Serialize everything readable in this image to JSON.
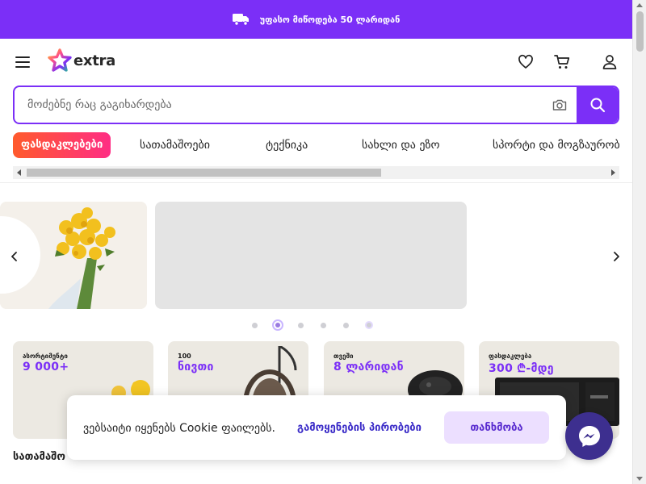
{
  "promo": {
    "text": "უფასო მიწოდება 50 ლარიდან"
  },
  "header": {
    "logo_text": "extra",
    "icons": [
      "menu-icon",
      "heart-icon",
      "cart-icon",
      "user-icon"
    ]
  },
  "search": {
    "placeholder": "მოძებნე რაც გაგიხარდება",
    "value": ""
  },
  "categories": [
    {
      "label": "ფასდაკლებები"
    },
    {
      "label": "სათამაშოები"
    },
    {
      "label": "ტექნიკა"
    },
    {
      "label": "სახლი და ეზო"
    },
    {
      "label": "სპორტი და მოგზაურობა"
    }
  ],
  "carousel": {
    "dot_count": 6,
    "active_index": 1
  },
  "tiles": [
    {
      "small": "ასორტიმენტი",
      "big": "9 000+",
      "label": "სათამაშო"
    },
    {
      "small": "100",
      "big": "ნივთი",
      "label": ""
    },
    {
      "small": "თვეში",
      "big": "8 ლარიდან",
      "label": ""
    },
    {
      "small": "ფასდაკლება",
      "big": "300 ₾-მდე",
      "label": ""
    }
  ],
  "cookie": {
    "message": "ვებსაიტი იყენებს Cookie ფაილებს.",
    "link": "გამოყენების პირობები",
    "accept": "თანხმობა"
  },
  "colors": {
    "accent": "#7b2ff7",
    "promo_bg": "#7b2ff7",
    "sale_gradient_start": "#ff5a2c",
    "sale_gradient_end": "#ff2d84",
    "messenger": "#3d2f8f"
  }
}
